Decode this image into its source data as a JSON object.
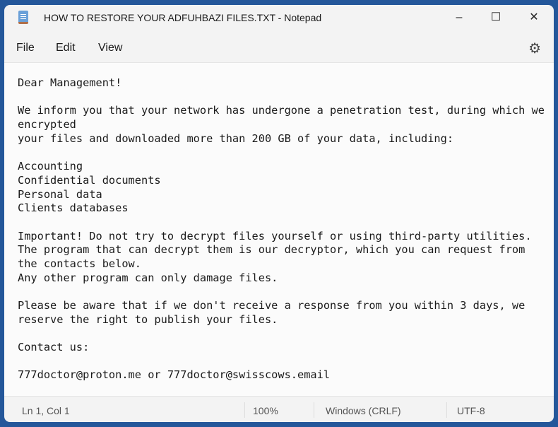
{
  "window": {
    "title": "HOW TO RESTORE YOUR ADFUHBAZI FILES.TXT - Notepad",
    "minimize": "–",
    "maximize": "☐",
    "close": "✕"
  },
  "menu": {
    "items": [
      "File",
      "Edit",
      "View"
    ],
    "settings_icon": "gear-icon"
  },
  "document": {
    "lines": [
      "Dear Management!",
      "",
      "We inform you that your network has undergone a penetration test, during which we",
      "encrypted",
      "your files and downloaded more than 200 GB of your data, including:",
      "",
      "Accounting",
      "Confidential documents",
      "Personal data",
      "Clients databases",
      "",
      "Important! Do not try to decrypt files yourself or using third-party utilities.",
      "The program that can decrypt them is our decryptor, which you can request from",
      "the contacts below.",
      "Any other program can only damage files.",
      "",
      "Please be aware that if we don't receive a response from you within 3 days, we",
      "reserve the right to publish your files.",
      "",
      "Contact us:",
      "",
      "777doctor@proton.me or 777doctor@swisscows.email"
    ]
  },
  "status": {
    "position": "Ln 1, Col 1",
    "zoom": "100%",
    "line_ending": "Windows (CRLF)",
    "encoding": "UTF-8"
  }
}
